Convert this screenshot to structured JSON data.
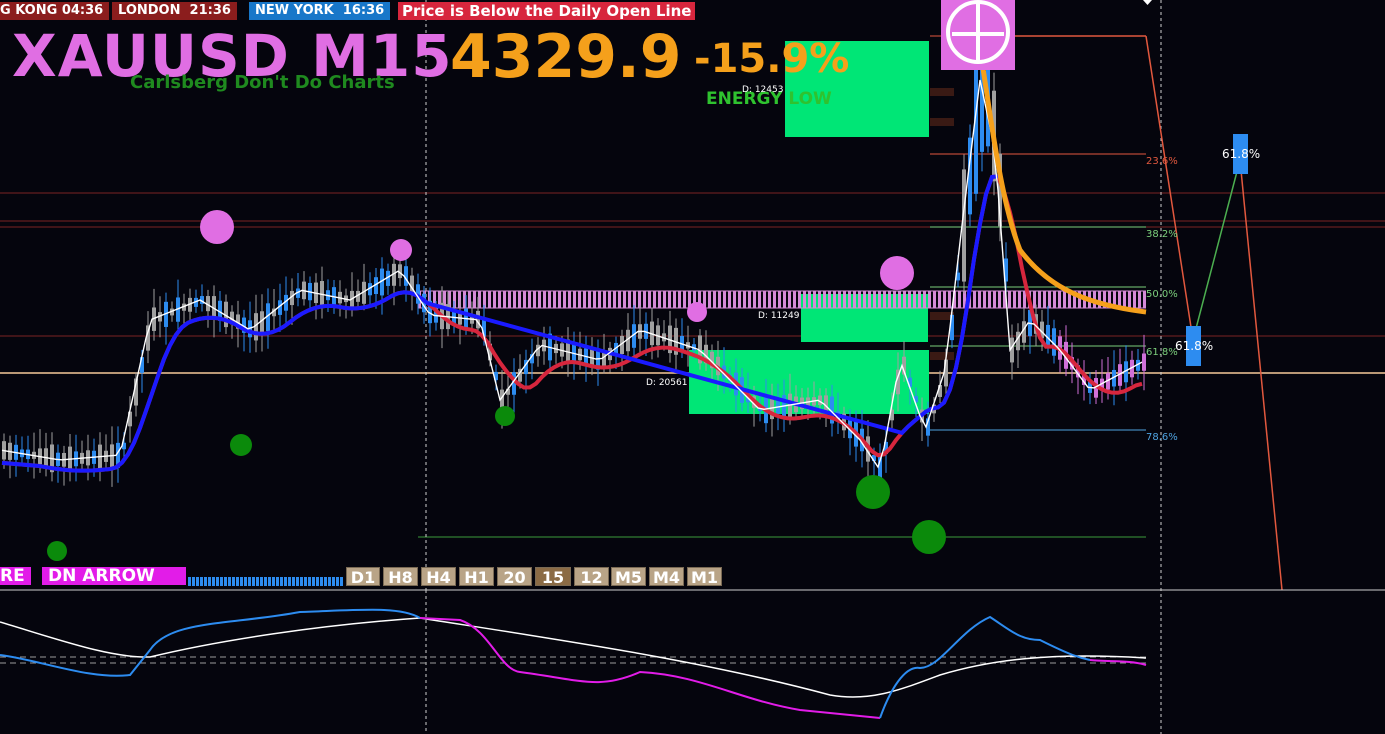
{
  "clocks": [
    {
      "city": "G KONG",
      "time": "04:36",
      "bg": "#8b1d1d"
    },
    {
      "city": "LONDON",
      "time": "21:36",
      "bg": "#8b1d1d"
    },
    {
      "city": "NEW YORK",
      "time": "16:36",
      "bg": "#1877c9"
    }
  ],
  "alert": "Price is Below the Daily Open Line",
  "symbol": "XAUUSD M15",
  "subtitle": "Carlsberg Don't Do Charts",
  "price": "4329.9",
  "change": "-15.9%",
  "energy": "ENERGY LOW",
  "zones": {
    "d1": "D: 12453",
    "d2": "D: 11249",
    "d3": "D: 20561"
  },
  "fib_levels": [
    "23.6%",
    "38.2%",
    "50.0%",
    "61.8%",
    "78.6%"
  ],
  "fib_big": [
    "61.8%",
    "61.8%"
  ],
  "signals": {
    "left": "RE",
    "arrow": "DN ARROW"
  },
  "timeframes": [
    "D1",
    "H8",
    "H4",
    "H1",
    "20",
    "15",
    "12",
    "M5",
    "M4",
    "M1"
  ],
  "colors": {
    "bull": "#2d8cf0",
    "bear": "#a0a0a0",
    "ma_up": "#1a1aff",
    "ma_down": "#d7263d",
    "accent": "#f5a01b",
    "zone": "#00e676",
    "pink": "#e06ee3"
  }
}
